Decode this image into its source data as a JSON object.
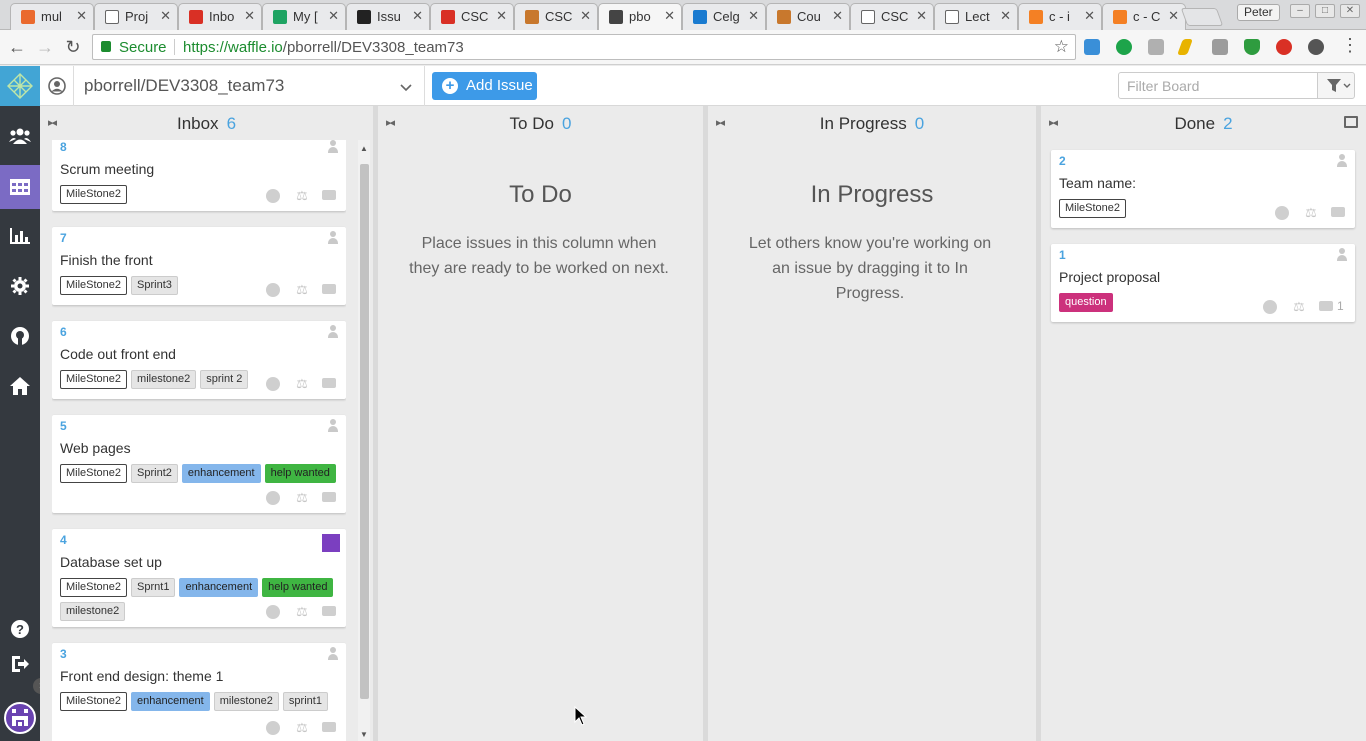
{
  "browser": {
    "tabs": [
      {
        "title": "mul",
        "color": "#ea6a2e"
      },
      {
        "title": "Proj",
        "color": "#ffffff"
      },
      {
        "title": "Inbo",
        "color": "#d93025"
      },
      {
        "title": "My [",
        "color": "#1fa463"
      },
      {
        "title": "Issu",
        "color": "#222222"
      },
      {
        "title": "CSC",
        "color": "#d93025"
      },
      {
        "title": "CSC",
        "color": "#c8782d"
      },
      {
        "title": "pbo",
        "color": "#444444"
      },
      {
        "title": "Celg",
        "color": "#1a7bd0"
      },
      {
        "title": "Cou",
        "color": "#c8782d"
      },
      {
        "title": "CSC",
        "color": "#ffffff"
      },
      {
        "title": "Lect",
        "color": "#ffffff"
      },
      {
        "title": "c - i",
        "color": "#f48024"
      },
      {
        "title": "c - C",
        "color": "#f48024"
      }
    ],
    "active_tab": 7,
    "close_glyph": "✕",
    "profile": "Peter",
    "secure_label": "Secure",
    "url_host": "https://waffle.io",
    "url_path": "/pborrell/DEV3308_team73",
    "back_icon": "←",
    "forward_icon": "→",
    "reload_icon": "↻",
    "star_icon": "☆",
    "menu_icon": "⋮"
  },
  "app": {
    "repo": "pborrell/DEV3308_team73",
    "add_issue": "Add Issue",
    "filter_placeholder": "Filter Board",
    "columns": [
      {
        "title": "Inbox",
        "count": "6"
      },
      {
        "title": "To Do",
        "count": "0",
        "empty_title": "To Do",
        "empty_text": "Place issues in this column when they are ready to be worked on next."
      },
      {
        "title": "In Progress",
        "count": "0",
        "empty_title": "In Progress",
        "empty_text": "Let others know you're working on an issue by dragging it to In Progress."
      },
      {
        "title": "Done",
        "count": "2"
      }
    ],
    "inbox_cards": [
      {
        "num": "8",
        "title": "Scrum meeting",
        "labels": [
          {
            "text": "MileStone2",
            "style": "outline"
          }
        ]
      },
      {
        "num": "7",
        "title": "Finish the front",
        "labels": [
          {
            "text": "MileStone2",
            "style": "outline"
          },
          {
            "text": "Sprint3",
            "style": "grey"
          }
        ]
      },
      {
        "num": "6",
        "title": "Code out front end",
        "labels": [
          {
            "text": "MileStone2",
            "style": "outline"
          },
          {
            "text": "milestone2",
            "style": "grey"
          },
          {
            "text": "sprint 2",
            "style": "grey"
          }
        ]
      },
      {
        "num": "5",
        "title": "Web pages",
        "labels": [
          {
            "text": "MileStone2",
            "style": "outline"
          },
          {
            "text": "Sprint2",
            "style": "grey"
          },
          {
            "text": "enhancement",
            "style": "blue"
          },
          {
            "text": "help wanted",
            "style": "green"
          }
        ]
      },
      {
        "num": "4",
        "title": "Database set up",
        "labels": [
          {
            "text": "MileStone2",
            "style": "outline"
          },
          {
            "text": "Sprnt1",
            "style": "grey"
          },
          {
            "text": "enhancement",
            "style": "blue"
          },
          {
            "text": "help wanted",
            "style": "green"
          },
          {
            "text": "milestone2",
            "style": "grey"
          }
        ]
      },
      {
        "num": "3",
        "title": "Front end design: theme 1",
        "labels": [
          {
            "text": "MileStone2",
            "style": "outline"
          },
          {
            "text": "enhancement",
            "style": "blue"
          },
          {
            "text": "milestone2",
            "style": "grey"
          },
          {
            "text": "sprint1",
            "style": "grey"
          }
        ]
      }
    ],
    "done_cards": [
      {
        "num": "2",
        "title": "Team name:",
        "labels": [
          {
            "text": "MileStone2",
            "style": "outline"
          }
        ],
        "comments": ""
      },
      {
        "num": "1",
        "title": "Project proposal",
        "labels": [
          {
            "text": "question",
            "style": "pink"
          }
        ],
        "comments": "1"
      }
    ]
  }
}
